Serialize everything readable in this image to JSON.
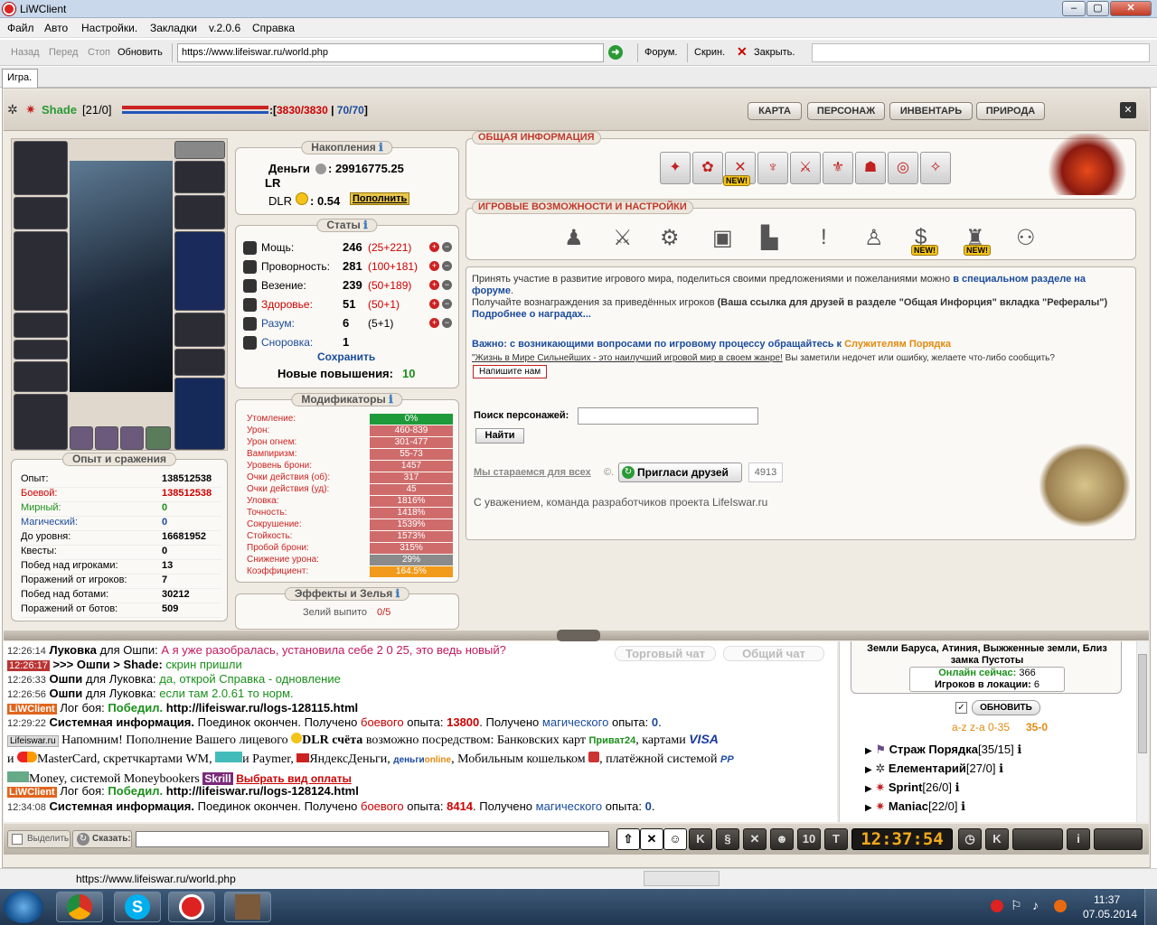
{
  "window": {
    "title": "LiWClient",
    "min": "–",
    "max": "▢",
    "close": "✕"
  },
  "menu": [
    "Файл",
    "Авто",
    "Настройки.",
    "Закладки",
    "v.2.0.6",
    "Справка"
  ],
  "nav": {
    "back": "Назад",
    "forward": "Перед",
    "stop": "Стоп",
    "refresh": "Обновить",
    "url": "https://www.lifeiswar.ru/world.php",
    "forum": "Форум.",
    "screen": "Скрин.",
    "close": "Закрыть."
  },
  "tab": "Игра.",
  "player": {
    "name": "Shade",
    "level": "[21/0]",
    "hp": "3830",
    "hp_max": "3830",
    "mp": "70",
    "mp_max": "70"
  },
  "top_buttons": [
    "КАРТА",
    "ПЕРСОНАЖ",
    "ИНВЕНТАРЬ",
    "ПРИРОДА"
  ],
  "savings": {
    "title": "Накопления",
    "money_label": "Деньги",
    "money_value": "29916775.25",
    "lr": "LR",
    "dlr_label": "DLR",
    "dlr_value": ": 0.54",
    "topup": "Пополнить"
  },
  "stats": {
    "title": "Статы",
    "rows": [
      {
        "label": "Мощь:",
        "value": "246",
        "extra": "(25+221)"
      },
      {
        "label": "Проворность:",
        "value": "281",
        "extra": "(100+181)"
      },
      {
        "label": "Везение:",
        "value": "239",
        "extra": "(50+189)"
      },
      {
        "label": "Здоровье:",
        "value": "51",
        "extra": "(50+1)"
      },
      {
        "label": "Разум:",
        "value": "6",
        "extra": "(5+1)"
      },
      {
        "label": "Сноровка:",
        "value": "1",
        "extra": ""
      }
    ],
    "save": "Сохранить",
    "new_ups_label": "Новые повышения:",
    "new_ups_value": "10"
  },
  "modifiers": {
    "title": "Модификаторы",
    "rows": [
      {
        "label": "Утомление:",
        "value": "0%",
        "color": "#1f9a3a"
      },
      {
        "label": "Урон:",
        "value": "460-839",
        "color": "#cf6b6b"
      },
      {
        "label": "Урон огнем:",
        "value": "301-477",
        "color": "#cf6b6b"
      },
      {
        "label": "Вампиризм:",
        "value": "55-73",
        "color": "#cf6b6b"
      },
      {
        "label": "Уровень брони:",
        "value": "1457",
        "color": "#cf6b6b"
      },
      {
        "label": "Очки действия (об):",
        "value": "317",
        "color": "#cf6b6b"
      },
      {
        "label": "Очки действия (уд):",
        "value": "45",
        "color": "#cf6b6b"
      },
      {
        "label": "Уловка:",
        "value": "1816%",
        "color": "#cf6b6b"
      },
      {
        "label": "Точность:",
        "value": "1418%",
        "color": "#cf6b6b"
      },
      {
        "label": "Сокрушение:",
        "value": "1539%",
        "color": "#cf6b6b"
      },
      {
        "label": "Стойкость:",
        "value": "1573%",
        "color": "#cf6b6b"
      },
      {
        "label": "Пробой брони:",
        "value": "315%",
        "color": "#cf6b6b"
      },
      {
        "label": "Снижение урона:",
        "value": "29%",
        "color": "#8a8a8a"
      },
      {
        "label": "Коэффициент:",
        "value": "164.5%",
        "color": "#f29a1a"
      }
    ]
  },
  "effects": {
    "title": "Эффекты и Зелья",
    "potions_label": "Зелий выпито",
    "potions_value": "0/5"
  },
  "experience": {
    "title": "Опыт и сражения",
    "rows": [
      {
        "label": "Опыт:",
        "value": "138512538",
        "lc": "#000",
        "vc": "#000"
      },
      {
        "label": "Боевой:",
        "value": "138512538",
        "lc": "#cc0000",
        "vc": "#cc0000"
      },
      {
        "label": "Мирный:",
        "value": "0",
        "lc": "#1a8f1a",
        "vc": "#1a8f1a"
      },
      {
        "label": "Магический:",
        "value": "0",
        "lc": "#1a4b9c",
        "vc": "#1a4b9c"
      },
      {
        "label": "До уровня:",
        "value": "16681952",
        "lc": "#000",
        "vc": "#000"
      },
      {
        "label": "Квесты:",
        "value": "0",
        "lc": "#000",
        "vc": "#000"
      },
      {
        "label": "Побед над игроками:",
        "value": "13",
        "lc": "#000",
        "vc": "#000"
      },
      {
        "label": "Поражений от игроков:",
        "value": "7",
        "lc": "#000",
        "vc": "#000"
      },
      {
        "label": "Побед над ботами:",
        "value": "30212",
        "lc": "#000",
        "vc": "#000"
      },
      {
        "label": "Поражений от ботов:",
        "value": "509",
        "lc": "#000",
        "vc": "#000"
      }
    ]
  },
  "general": {
    "title": "ОБЩАЯ ИНФОРМАЦИЯ",
    "new_badge": "NEW!"
  },
  "features": {
    "title": "ИГРОВЫЕ ВОЗМОЖНОСТИ И НАСТРОЙКИ",
    "new_badge": "NEW!"
  },
  "info": {
    "p1a": "Принять участие в развитие игрового мира, поделиться своими предложениями и пожеланиями можно",
    "p1link": "в специальном разделе на форуме",
    "p2a": "Получайте вознаграждения за приведённых игроков",
    "p2b": "(Ваша ссылка для друзей в разделе \"Общая Инфорция\" вкладка \"Рефералы\")",
    "p2link": "Подробнее о наградах...",
    "important": "Важно:",
    "important_text": "с возникающими вопросами по игровому процессу обращайтесь к",
    "important_link": "Служителям Порядка",
    "slogan": "\"Жизнь в Мире Сильнейших - это наилучший игровой мир в своем жанре!",
    "slogan2": "Вы заметили недочет или ошибку, желаете что-либо сообщить?",
    "write_us": "Напишите нам",
    "search_label": "Поиск персонажей:",
    "search_btn": "Найти",
    "trying": "Мы стараемся для всех",
    "copy": "©.",
    "invite": "Пригласи друзей",
    "invite_count": "4913",
    "regards": "С уважением, команда разработчиков проекта LifeIswar.ru"
  },
  "chat_tabs": {
    "trade": "Торговый чат",
    "common": "Общий чат"
  },
  "chat": [
    {
      "time": "12:26:14",
      "who": "Луковка",
      "mid": "для Ошпи:",
      "text": "А я уже разобралась, установила себе 2 0 25, это ведь новый?",
      "tc": "#c2185b"
    },
    {
      "time": "12:26:17",
      "who": ">>> Ошпи > Shade:",
      "mid": "",
      "text": "скрин пришли",
      "tc": "#1a8f1a"
    },
    {
      "time": "12:26:33",
      "who": "Ошпи",
      "mid": "для Луковка:",
      "text": "да, открой Справка - одновление",
      "tc": "#1a8f1a"
    },
    {
      "time": "12:26:56",
      "who": "Ошпи",
      "mid": "для Луковка:",
      "text": "если там 2.0.61 то норм.",
      "tc": "#1a8f1a"
    }
  ],
  "log1": {
    "tag": "LiWClient",
    "prefix": "Лог боя:",
    "result": "Победил.",
    "link": "http://lifeiswar.ru/logs-128115.html"
  },
  "sys1": {
    "time": "12:29:22",
    "label": "Системная информация.",
    "text": "Поединок окончен. Получено",
    "w1": "боевого",
    "t2": "опыта:",
    "v1": "13800",
    "t3": ". Получено",
    "w2": "магического",
    "t4": "опыта:",
    "v2": "0",
    "t5": "."
  },
  "promo": {
    "tag": "Lifeiswar.ru",
    "l1": "Напомним! Пополнение Вашего лицевого",
    "dlr": "DLR счёта",
    "l1b": "возможно посредством: Банковских карт",
    "privat": "Приват24",
    "l1c": ", картами",
    "visa": "VISA",
    "l2a": "и",
    "l2b": "MasterCard, скретчкартами WM,",
    "l2c": "и Paymer,",
    "l2d": "ЯндексДеньги,",
    "dengi": "деньги",
    "online": "online",
    "l2e": ", Мобильным кошельком",
    "l2f": ", платёжной системой",
    "l3a": "Money, системой Moneybookers",
    "skrill": "Skrill",
    "l3link": "Выбрать вид оплаты"
  },
  "log2": {
    "tag": "LiWClient",
    "prefix": "Лог боя:",
    "result": "Победил.",
    "link": "http://lifeiswar.ru/logs-128124.html"
  },
  "sys2": {
    "time": "12:34:08",
    "label": "Системная информация.",
    "text": "Поединок окончен. Получено",
    "w1": "боевого",
    "t2": "опыта:",
    "v1": "8414",
    "t3": ". Получено",
    "w2": "магического",
    "t4": "опыта:",
    "v2": "0",
    "t5": "."
  },
  "online": {
    "location": "Земли Баруса, Атиния, Выжженные земли, Близ замка Пустоты",
    "online_label": "Онлайн сейчас:",
    "online_value": "366",
    "loc_label": "Игроков в локации:",
    "loc_value": "6",
    "refresh": "ОБНОВИТЬ",
    "sort": "а-z z-а 0-35",
    "sort_bold": "35-0",
    "players": [
      {
        "name": "Страж Порядка",
        "lvl": "[35/15]"
      },
      {
        "name": "Елементарий",
        "lvl": "[27/0]"
      },
      {
        "name": "Sprint",
        "lvl": "[26/0]"
      },
      {
        "name": "Maniac",
        "lvl": "[22/0]"
      }
    ]
  },
  "bottom": {
    "select": "Выделить",
    "say": "Сказать:",
    "clock": "12:37:54"
  },
  "status": {
    "url": "https://www.lifeiswar.ru/world.php"
  },
  "taskbar": {
    "time": "11:37",
    "date": "07.05.2014"
  }
}
